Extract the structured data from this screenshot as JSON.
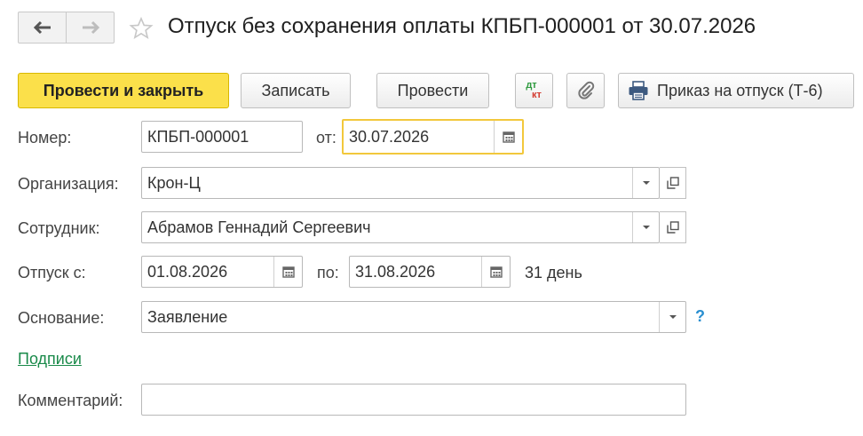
{
  "header": {
    "title": "Отпуск без сохранения оплаты КПБП-000001 от 30.07.2026"
  },
  "toolbar": {
    "post_and_close": "Провести и закрыть",
    "save": "Записать",
    "post": "Провести",
    "dtkt_top": "дт",
    "dtkt_bottom": "кт",
    "print_order": "Приказ на отпуск (Т-6)"
  },
  "form": {
    "number_label": "Номер:",
    "number_value": "КПБП-000001",
    "date_label": "от:",
    "date_value": "30.07.2026",
    "organization_label": "Организация:",
    "organization_value": "Крон-Ц",
    "employee_label": "Сотрудник:",
    "employee_value": "Абрамов Геннадий Сергеевич",
    "vacation_from_label": "Отпуск с:",
    "vacation_from_value": "01.08.2026",
    "vacation_to_label": "по:",
    "vacation_to_value": "31.08.2026",
    "duration": "31 день",
    "basis_label": "Основание:",
    "basis_value": "Заявление",
    "help": "?",
    "signatures_link": "Подписи",
    "comment_label": "Комментарий:",
    "comment_value": ""
  },
  "colors": {
    "primary_button": "#fbe04a",
    "focus_border": "#f2c83c",
    "link": "#1a8a4a",
    "help": "#2a8fd0"
  }
}
